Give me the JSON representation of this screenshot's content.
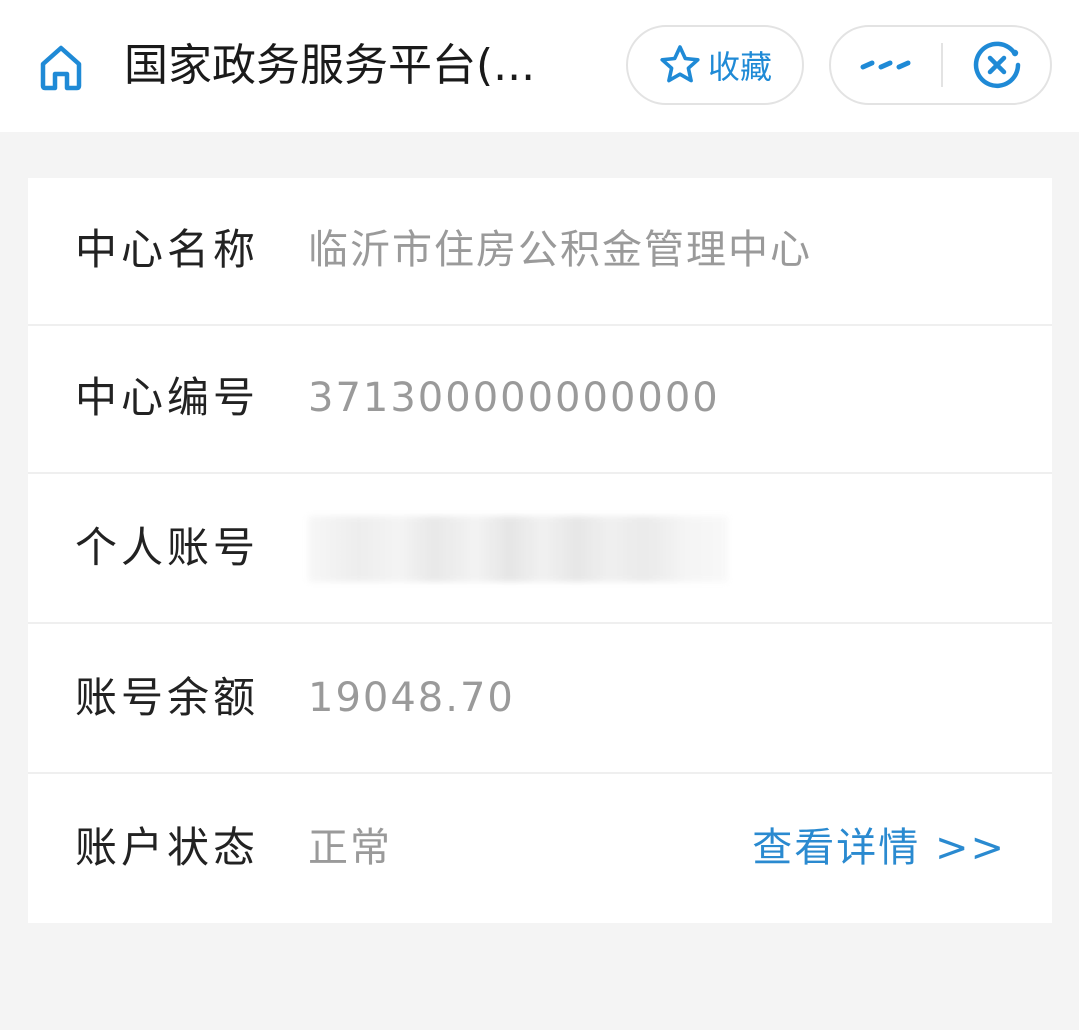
{
  "header": {
    "title": "国家政务服务平台(...",
    "favorite_label": "收藏",
    "icons": {
      "home": "home-icon",
      "favorite": "star-icon",
      "more": "more-dots-icon",
      "close": "close-circle-icon"
    },
    "accent_color": "#1f8ad6"
  },
  "info": {
    "rows": [
      {
        "label": "中心名称",
        "value": "临沂市住房公积金管理中心"
      },
      {
        "label": "中心编号",
        "value": "371300000000000"
      },
      {
        "label": "个人账号",
        "value": ""
      },
      {
        "label": "账号余额",
        "value": "19048.70"
      },
      {
        "label": "账户状态",
        "value": "正常",
        "link": "查看详情 >>"
      }
    ]
  }
}
